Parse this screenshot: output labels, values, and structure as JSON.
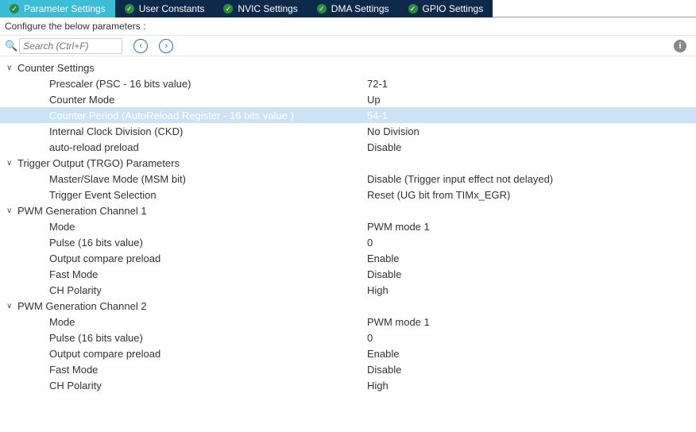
{
  "tabs": [
    {
      "label": "Parameter Settings",
      "active": true
    },
    {
      "label": "User Constants",
      "active": false
    },
    {
      "label": "NVIC Settings",
      "active": false
    },
    {
      "label": "DMA Settings",
      "active": false
    },
    {
      "label": "GPIO Settings",
      "active": false
    }
  ],
  "instruction": "Configure the below parameters :",
  "search": {
    "placeholder": "Search (Ctrl+F)"
  },
  "groups": [
    {
      "name": "Counter Settings",
      "rows": [
        {
          "label": "Prescaler (PSC - 16 bits value)",
          "value": "72-1",
          "selected": false
        },
        {
          "label": "Counter Mode",
          "value": "Up",
          "selected": false
        },
        {
          "label": "Counter Period (AutoReload Register - 16 bits value )",
          "value": "54-1",
          "selected": true
        },
        {
          "label": "Internal Clock Division (CKD)",
          "value": "No Division",
          "selected": false
        },
        {
          "label": "auto-reload preload",
          "value": "Disable",
          "selected": false
        }
      ]
    },
    {
      "name": "Trigger Output (TRGO) Parameters",
      "rows": [
        {
          "label": "Master/Slave Mode (MSM bit)",
          "value": "Disable (Trigger input effect not delayed)",
          "selected": false
        },
        {
          "label": "Trigger Event Selection",
          "value": "Reset (UG bit from TIMx_EGR)",
          "selected": false
        }
      ]
    },
    {
      "name": "PWM Generation Channel 1",
      "rows": [
        {
          "label": "Mode",
          "value": "PWM mode 1",
          "selected": false
        },
        {
          "label": "Pulse (16 bits value)",
          "value": "0",
          "selected": false
        },
        {
          "label": "Output compare preload",
          "value": "Enable",
          "selected": false
        },
        {
          "label": "Fast Mode",
          "value": "Disable",
          "selected": false
        },
        {
          "label": "CH Polarity",
          "value": "High",
          "selected": false
        }
      ]
    },
    {
      "name": "PWM Generation Channel 2",
      "rows": [
        {
          "label": "Mode",
          "value": "PWM mode 1",
          "selected": false
        },
        {
          "label": "Pulse (16 bits value)",
          "value": "0",
          "selected": false
        },
        {
          "label": "Output compare preload",
          "value": "Enable",
          "selected": false
        },
        {
          "label": "Fast Mode",
          "value": "Disable",
          "selected": false
        },
        {
          "label": "CH Polarity",
          "value": "High",
          "selected": false
        }
      ]
    }
  ]
}
